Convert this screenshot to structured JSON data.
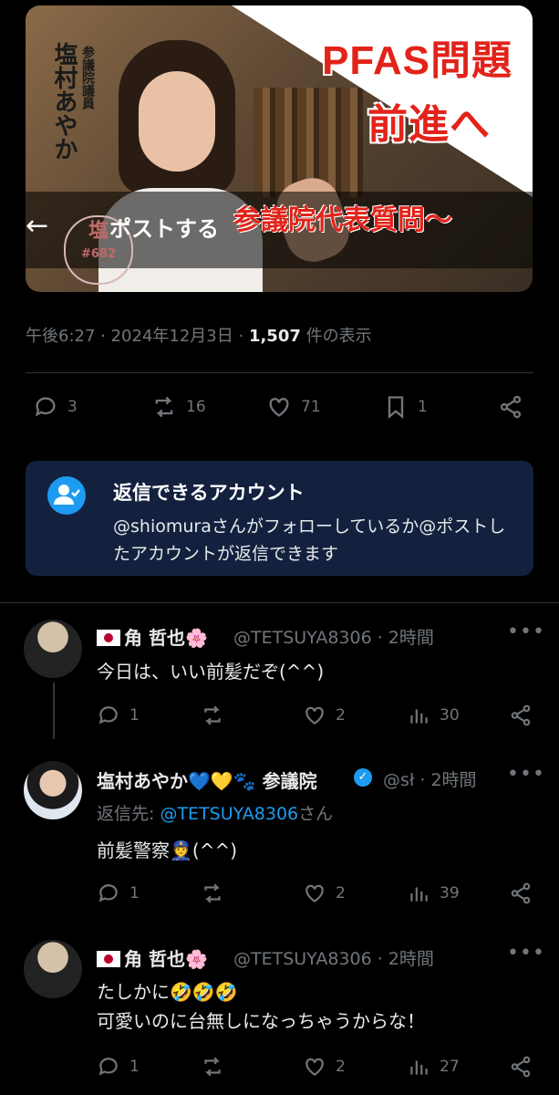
{
  "header": {
    "back_icon": "arrow-left-icon",
    "title": "ポストする"
  },
  "media": {
    "vertical_small": "参議院議員",
    "vertical_name": "塩村あやか",
    "headline_1": "PFAS問題",
    "headline_2": "前進へ",
    "subline": "参議院代表質問〜",
    "badge_top": "塩",
    "badge_num": "#682"
  },
  "post_meta": {
    "time": "午後6:27",
    "date": "2024年12月3日",
    "views": "1,507",
    "views_label": "件の表示"
  },
  "actions": {
    "replies": "3",
    "reposts": "16",
    "likes": "71",
    "bookmarks": "1"
  },
  "reply_restriction": {
    "title": "返信できるアカウント",
    "body": "@shiomuraさんがフォローしているか@ポストしたアカウントが返信できます"
  },
  "replies": [
    {
      "name": "角 哲也🌸",
      "handle": "@TETSUYA8306",
      "time": "2時間",
      "text": "今日は、いい前髪だぞ(^^)",
      "stats": {
        "replies": "1",
        "likes": "2",
        "views": "30"
      }
    },
    {
      "name": "塩村あやか💙💛🐾 参議院",
      "handle": "@sł",
      "time": "2時間",
      "reply_to_label": "返信先: ",
      "reply_to": "@TETSUYA8306",
      "reply_to_suffix": "さん",
      "text": "前髪警察👮(^^)",
      "stats": {
        "replies": "1",
        "likes": "2",
        "views": "39"
      }
    },
    {
      "name": "角 哲也🌸",
      "handle": "@TETSUYA8306",
      "time": "2時間",
      "text_1": "たしかに🤣🤣🤣",
      "text_2": "可愛いのに台無しになっちゃうからな！",
      "stats": {
        "replies": "1",
        "likes": "2",
        "views": "27"
      }
    }
  ],
  "colors": {
    "background": "#000000",
    "accent": "#1d9bf0",
    "muted": "#71767b",
    "reply_box": "#13213f"
  }
}
